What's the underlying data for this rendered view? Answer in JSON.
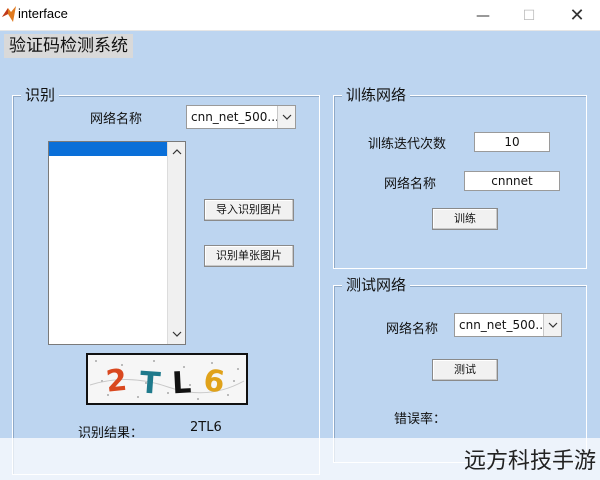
{
  "window": {
    "title": "interface",
    "min_glyph": "—",
    "max_glyph": "☐",
    "close_glyph": "✕"
  },
  "app": {
    "heading": "验证码检测系统"
  },
  "recognize": {
    "title": "识别",
    "network_label": "网络名称",
    "network_selected": "cnn_net_500....",
    "import_button": "导入识别图片",
    "single_button": "识别单张图片",
    "captcha_chars": [
      "2",
      "T",
      "L",
      "6"
    ],
    "result_label": "识别结果：",
    "result_value": "2TL6"
  },
  "train": {
    "title": "训练网络",
    "iterations_label": "训练迭代次数",
    "iterations_value": "10",
    "network_label": "网络名称",
    "network_value": "cnnnet",
    "train_button": "训练"
  },
  "test": {
    "title": "测试网络",
    "network_label": "网络名称",
    "network_selected": "cnn_net_500....",
    "test_button": "测试",
    "error_label": "错误率："
  },
  "watermark": {
    "text": "远方科技手游"
  },
  "icons": {
    "app": "matlab-icon",
    "dropdown": "chevron-down-icon",
    "scroll_up": "scroll-up-icon",
    "scroll_down": "scroll-down-icon"
  },
  "colors": {
    "background": "#bdd5f0",
    "selection": "#0a6fd8",
    "captcha_2": "#d9481f",
    "captcha_T": "#1f7a8c",
    "captcha_L": "#111111",
    "captcha_6": "#e0a21a"
  }
}
